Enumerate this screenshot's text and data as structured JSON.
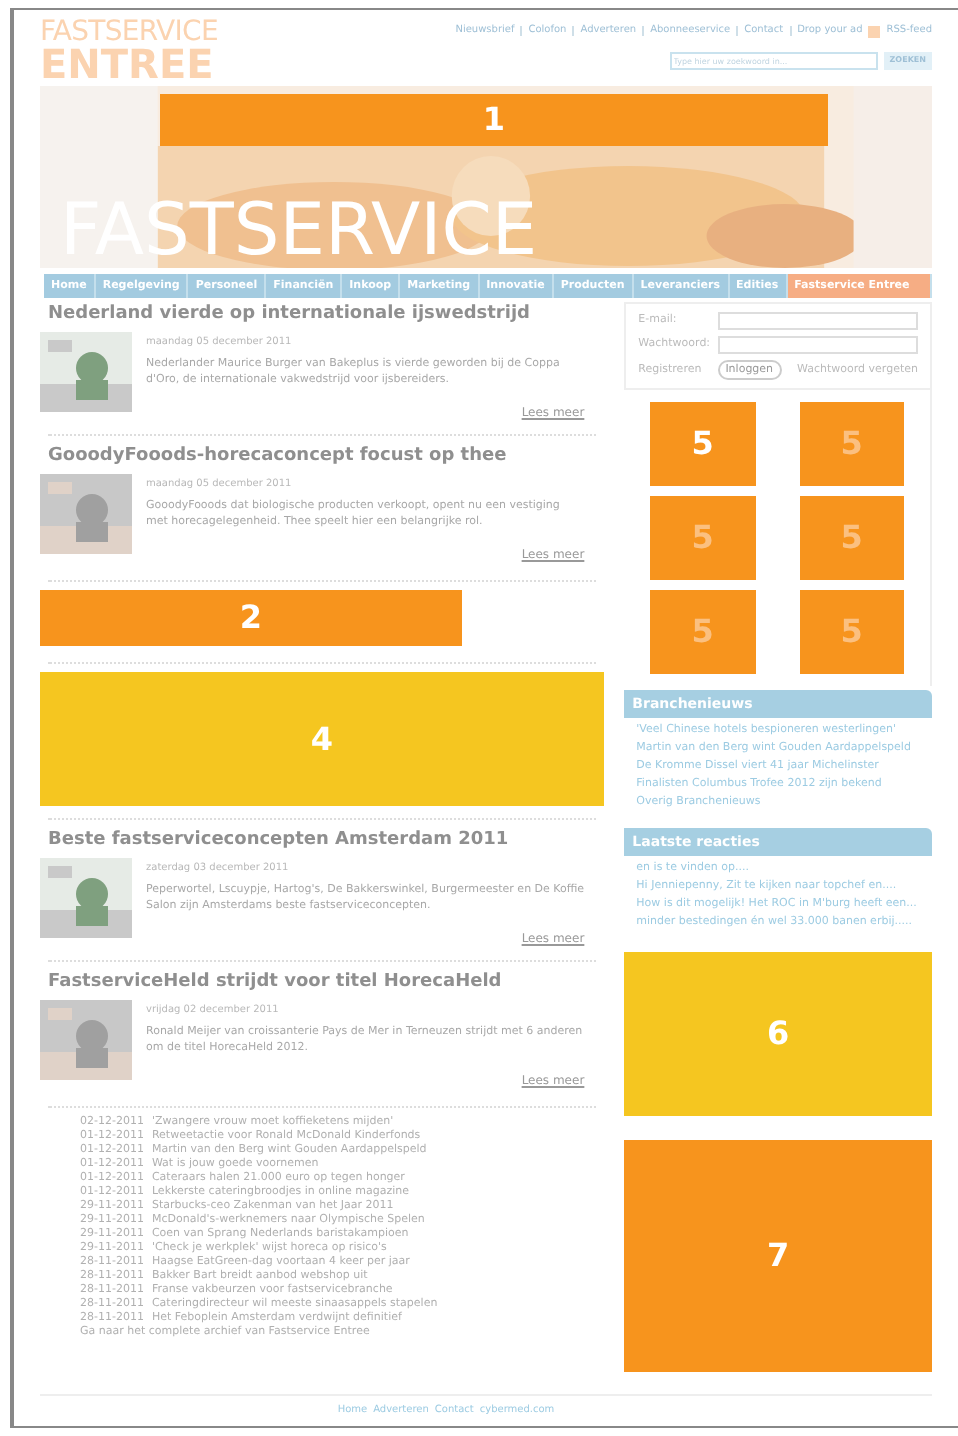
{
  "logo": {
    "line1": "FASTSERVICE",
    "line2": "ENTREE"
  },
  "top_links": [
    "Nieuwsbrief",
    "Colofon",
    "Adverteren",
    "Abonneeservice",
    "Contact",
    "Drop your ad",
    "RSS-feed"
  ],
  "search": {
    "placeholder": "Type hier uw zoekwoord in...",
    "button": "ZOEKEN"
  },
  "banner": {
    "title": "FASTSERVICE",
    "ad": {
      "label": "1",
      "color": "#f7941d"
    }
  },
  "nav": [
    {
      "label": "Home",
      "selected": false
    },
    {
      "label": "Regelgeving",
      "selected": false
    },
    {
      "label": "Personeel",
      "selected": false
    },
    {
      "label": "Financiën",
      "selected": false
    },
    {
      "label": "Inkoop",
      "selected": false
    },
    {
      "label": "Marketing",
      "selected": false
    },
    {
      "label": "Innovatie",
      "selected": false
    },
    {
      "label": "Producten",
      "selected": false
    },
    {
      "label": "Leveranciers",
      "selected": false
    },
    {
      "label": "Edities",
      "selected": false
    },
    {
      "label": "Fastservice Entree",
      "selected": true
    }
  ],
  "content": [
    {
      "kind": "article",
      "title": "Nederland vierde op internationale ijswedstrijd",
      "date": "maandag 05 december 2011",
      "text": "Nederlander Maurice Burger van Bakeplus is vierde geworden bij de Coppa d'Oro, de internationale vakwedstrijd voor ijsbereiders.",
      "more": "Lees meer"
    },
    {
      "kind": "article",
      "title": "GooodyFooods-horecaconcept focust op thee",
      "date": "maandag 05 december 2011",
      "text": "GooodyFooods dat biologische producten verkoopt, opent nu een vestiging met horecagelegenheid. Thee speelt hier een belangrijke rol.",
      "more": "Lees meer"
    },
    {
      "kind": "small_ad",
      "label": "2",
      "color": "#f7941d"
    },
    {
      "kind": "large_ad",
      "label": "4",
      "color": "#f5c620"
    },
    {
      "kind": "article",
      "title": "Beste fastserviceconcepten Amsterdam 2011",
      "date": "zaterdag 03 december 2011",
      "text": "Peperwortel, Lscuypje, Hartog's, De Bakkerswinkel, Burgermeester en De Koffie Salon zijn Amsterdams beste fastserviceconcepten.",
      "more": "Lees meer"
    },
    {
      "kind": "article",
      "title": "FastserviceHeld strijdt voor titel HorecaHeld",
      "date": "vrijdag 02 december 2011",
      "text": "Ronald Meijer van croissanterie Pays de Mer in Terneuzen strijdt met 6 anderen om de titel HorecaHeld 2012.",
      "more": "Lees meer"
    }
  ],
  "archive": {
    "items": [
      {
        "date": "02-12-2011",
        "title": "'Zwangere vrouw moet koffieketens mijden'"
      },
      {
        "date": "01-12-2011",
        "title": "Retweetactie voor Ronald McDonald Kinderfonds"
      },
      {
        "date": "01-12-2011",
        "title": "Martin van den Berg wint Gouden Aardappelspeld"
      },
      {
        "date": "01-12-2011",
        "title": "Wat is jouw goede voornemen"
      },
      {
        "date": "01-12-2011",
        "title": "Cateraars halen 21.000 euro op tegen honger"
      },
      {
        "date": "01-12-2011",
        "title": "Lekkerste cateringbroodjes in online magazine"
      },
      {
        "date": "29-11-2011",
        "title": "Starbucks-ceo Zakenman van het Jaar 2011"
      },
      {
        "date": "29-11-2011",
        "title": "McDonald's-werknemers naar Olympische Spelen"
      },
      {
        "date": "29-11-2011",
        "title": "Coen van Sprang Nederlands baristakampioen"
      },
      {
        "date": "29-11-2011",
        "title": "'Check je werkplek' wijst horeca op risico's"
      },
      {
        "date": "28-11-2011",
        "title": "Haagse EatGreen-dag voortaan 4 keer per jaar"
      },
      {
        "date": "28-11-2011",
        "title": "Bakker Bart breidt aanbod webshop uit"
      },
      {
        "date": "28-11-2011",
        "title": "Franse vakbeurzen voor fastservicebranche"
      },
      {
        "date": "28-11-2011",
        "title": "Cateringdirecteur wil meeste sinaasappels stapelen"
      },
      {
        "date": "28-11-2011",
        "title": "Het Feboplein Amsterdam verdwijnt definitief"
      }
    ],
    "link": "Ga naar het complete archief van Fastservice Entree"
  },
  "login": {
    "email_label": "E-mail:",
    "password_label": "Wachtwoord:",
    "register": "Registreren",
    "button": "Inloggen",
    "forgot": "Wachtwoord vergeten"
  },
  "side_ads": [
    {
      "label": "5",
      "dim": false
    },
    {
      "label": "5",
      "dim": true
    },
    {
      "label": "5",
      "dim": true
    },
    {
      "label": "5",
      "dim": true
    },
    {
      "label": "5",
      "dim": true
    },
    {
      "label": "5",
      "dim": true
    }
  ],
  "branchenieuws": {
    "title": "Branchenieuws",
    "items": [
      "'Veel Chinese hotels bespioneren westerlingen'",
      "Martin van den Berg wint Gouden Aardappelspeld",
      "De Kromme Dissel viert 41 jaar Michelinster",
      "Finalisten Columbus Trofee 2012 zijn bekend",
      "Overig Branchenieuws"
    ]
  },
  "reacties": {
    "title": "Laatste reacties",
    "items": [
      "en is te vinden op....",
      "Hi Jenniepenny, Zit te kijken naar topchef en....",
      "How is dit mogelijk! Het ROC in M'burg heeft een...",
      "minder bestedingen én wel 33.000 banen erbij....."
    ]
  },
  "side_big_ads": [
    {
      "label": "6",
      "color": "#f5c620"
    },
    {
      "label": "7",
      "color": "#f7941d"
    }
  ],
  "footer": [
    "Home",
    "Adverteren",
    "Contact",
    "cybermed.com"
  ]
}
